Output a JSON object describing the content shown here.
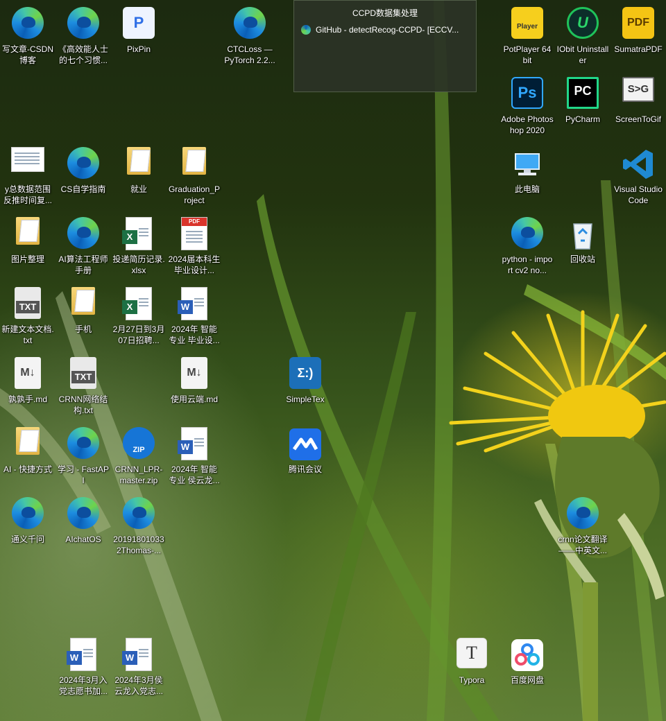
{
  "preview": {
    "title": "CCPD数据集处理",
    "item": "GitHub - detectRecog-CCPD- [ECCV..."
  },
  "icons": {
    "csdn": "写文章-CSDN博客",
    "habits": "《高效能人士的七个习惯...",
    "pixpin": "PixPin",
    "ctcloss": "CTCLoss — PyTorch 2.2...",
    "potplayer": "PotPlayer 64 bit",
    "iobit": "IObit Uninstaller",
    "sumatra": "SumatraPDF",
    "photoshop": "Adobe Photoshop 2020",
    "pycharm": "PyCharm",
    "screentogif": "ScreenToGif",
    "ydata": "y总数据范围反推时间复...",
    "csguide": "CS自学指南",
    "jiuye": "就业",
    "graduation": "Graduation_Project",
    "thispc": "此电脑",
    "vscode": "Visual Studio Code",
    "pictures": "图片整理",
    "aihandbook": "AI算法工程师手册",
    "resumexlsx": "投递简历记录.xlsx",
    "thesis2024": "2024届本科生毕业设计...",
    "python": "python - import cv2 no...",
    "recycle": "回收站",
    "newtxt": "新建文本文档.txt",
    "phone": "手机",
    "recruit": "2月27日到3月07日招聘...",
    "design2024": "2024年 智能专业 毕业设...",
    "shushu": "孰孰手.md",
    "crnntxt": "CRNN网络结构.txt",
    "cloud": "使用云端.md",
    "simpletex": "SimpleTex",
    "aishortcut": "AI - 快捷方式",
    "fastapi": "学习 - FastAPI",
    "crnnzip": "CRNN_LPR-master.zip",
    "hou2024": "2024年 智能专业 侯云龙...",
    "tencent": "腾讯会议",
    "tongyi": "通义千问",
    "aichatos": "AIchatOS",
    "thomas": "201918010332Thomas-...",
    "crnntrans": "crnn论文翻译——中英文...",
    "party1": "2024年3月入党志愿书加...",
    "party2": "2024年3月侯云龙入党志...",
    "typora": "Typora",
    "baidu": "百度网盘"
  },
  "badges": {
    "pdf": "PDF",
    "zip": "ZIP",
    "txt": "TXT",
    "x": "X",
    "w": "W",
    "ps": "Ps",
    "pc": "PC",
    "u": "U",
    "p": "P",
    "t": "T",
    "player": "Player",
    "sumatra": "PDF",
    "screentogif": "S>G",
    "md": "M↓",
    "simpletex": "Σ:)"
  }
}
